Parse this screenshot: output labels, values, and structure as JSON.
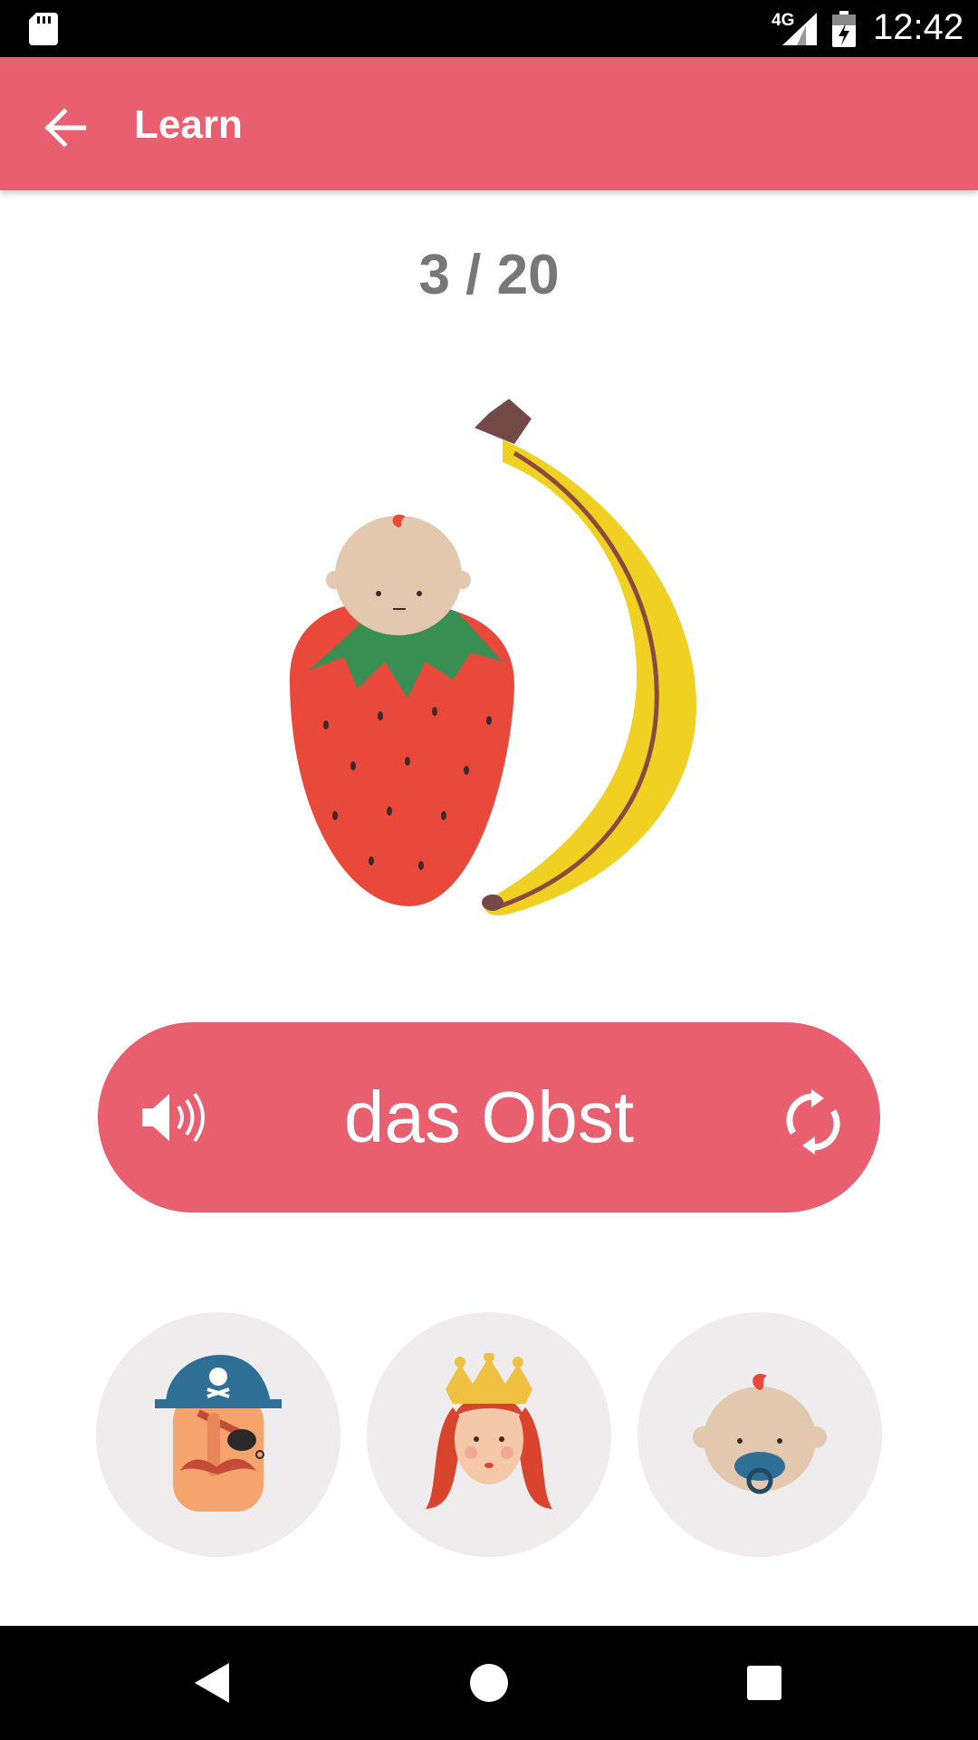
{
  "status_bar": {
    "network": "4G",
    "time": "12:42",
    "icons": [
      "sd-card-icon",
      "signal-icon",
      "battery-icon"
    ]
  },
  "app_bar": {
    "title": "Learn",
    "back_icon": "arrow-back-icon",
    "background": "#e85f70"
  },
  "progress": {
    "label": "3 / 20",
    "current": 3,
    "total": 20
  },
  "card": {
    "illustration": "strawberry-with-baby-head-and-banana",
    "word": "das Obst",
    "speaker_icon": "speaker-icon",
    "flip_icon": "refresh-icon",
    "accent": "#e85f70"
  },
  "choices": [
    {
      "id": "pirate",
      "icon": "pirate-icon"
    },
    {
      "id": "queen",
      "icon": "queen-icon"
    },
    {
      "id": "baby",
      "icon": "baby-icon"
    }
  ],
  "nav_bar": {
    "icons": [
      "back-triangle-icon",
      "home-circle-icon",
      "recents-square-icon"
    ]
  }
}
